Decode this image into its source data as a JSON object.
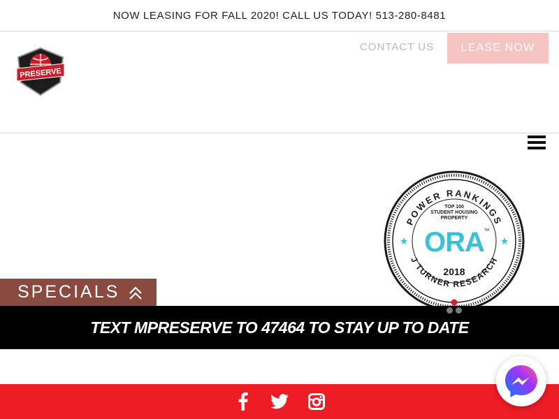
{
  "announcement": {
    "text": "NOW LEASING FOR FALL 2020! CALL US TODAY! 513-280-8481"
  },
  "nav": {
    "contact_label": "CONTACT US",
    "lease_label": "LEASE NOW"
  },
  "logo": {
    "text": "PRESERVE",
    "icon": "shield-globe-icon"
  },
  "hero": {
    "specials_label": "SPECIALS",
    "text_cta": "TEXT MPRESERVE TO 47464 TO STAY UP TO DATE",
    "badge": {
      "arc_top": "POWER RANKINGS",
      "line1": "TOP 100",
      "line2": "STUDENT HOUSING",
      "line3": "PROPERTY",
      "brand": "ORA",
      "tm": "TM",
      "year": "2018",
      "arc_bottom": "J TURNER RESEARCH"
    },
    "slides": {
      "count": 2,
      "active_index": 0
    }
  },
  "footer": {
    "social": [
      "facebook-icon",
      "twitter-icon",
      "instagram-icon"
    ]
  },
  "colors": {
    "accent_red": "#ee1c25",
    "lease_button": "#f7c4c4",
    "specials_bg": "#8a4a40",
    "ora_cyan": "#3cc0d6"
  }
}
